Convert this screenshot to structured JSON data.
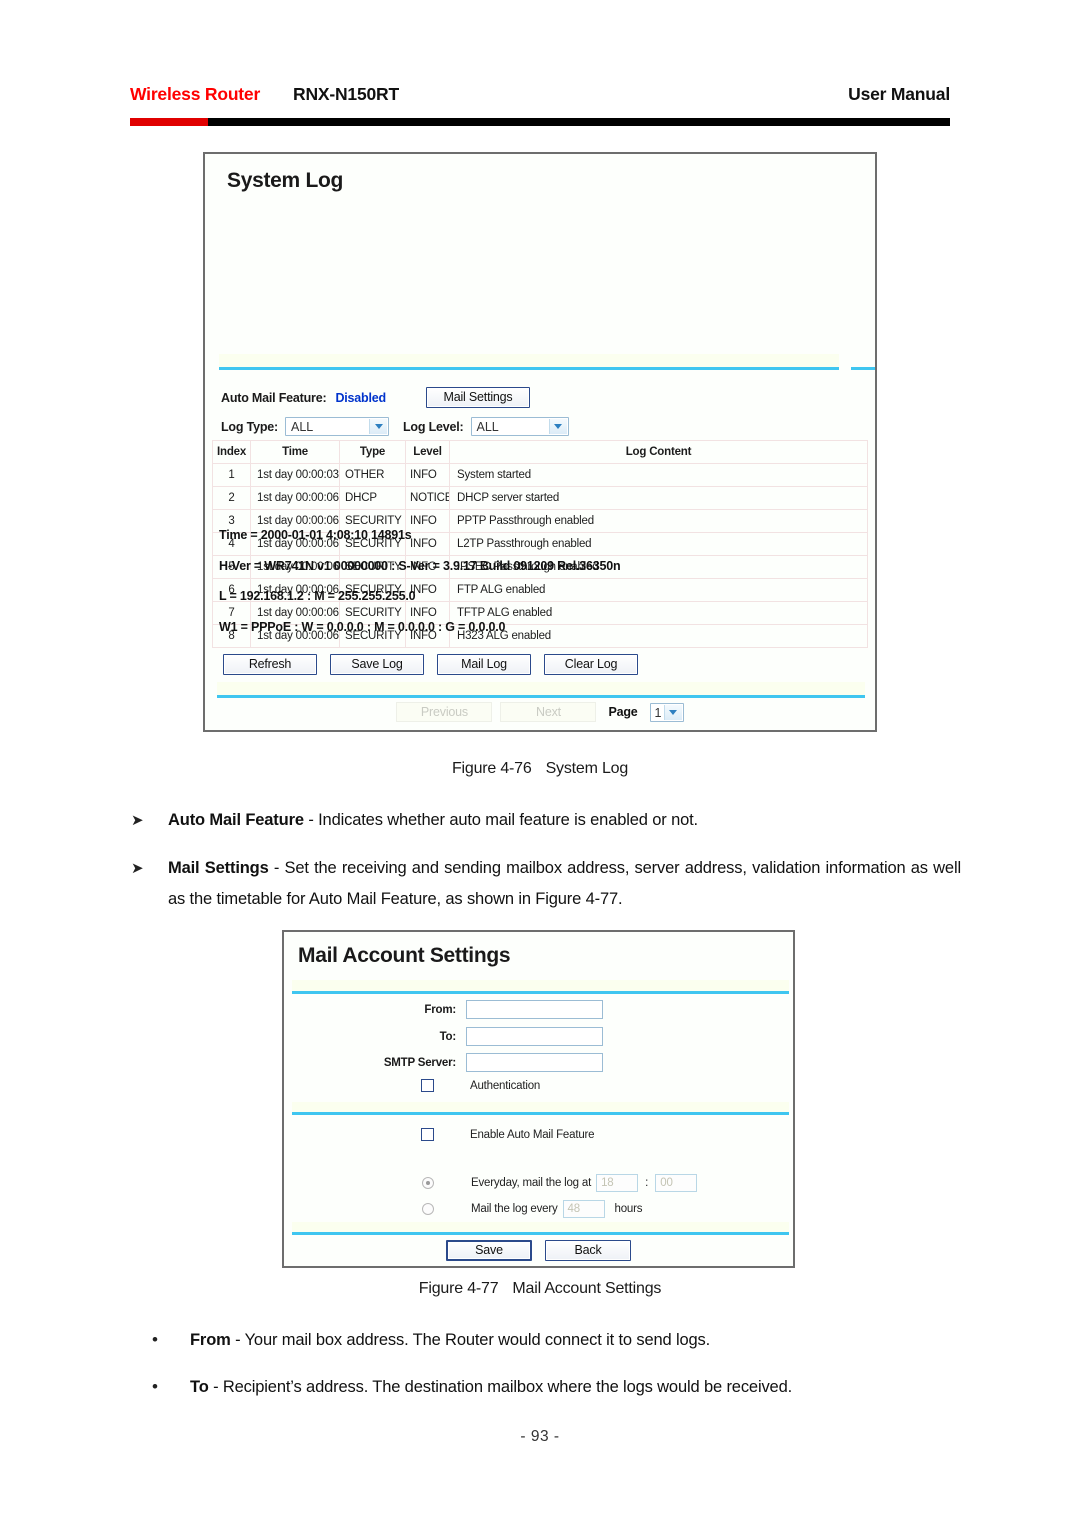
{
  "header": {
    "brand": "Wireless Router",
    "model": "RNX-N150RT",
    "manual": "User Manual",
    "brand_color": "#ff0000"
  },
  "system_log_panel": {
    "title": "System Log",
    "auto_mail_label": "Auto Mail Feature:",
    "auto_mail_value": "Disabled",
    "auto_mail_value_color": "#0033cc",
    "mail_settings_button": "Mail Settings",
    "log_type_label": "Log Type:",
    "log_type_value": "ALL",
    "log_level_label": "Log Level:",
    "log_level_value": "ALL",
    "table": {
      "headers": [
        "Index",
        "Time",
        "Type",
        "Level",
        "Log Content"
      ],
      "rows": [
        {
          "index": "1",
          "time": "1st day 00:00:03",
          "type": "OTHER",
          "level": "INFO",
          "content": "System started"
        },
        {
          "index": "2",
          "time": "1st day 00:00:06",
          "type": "DHCP",
          "level": "NOTICE",
          "content": "DHCP server started"
        },
        {
          "index": "3",
          "time": "1st day 00:00:06",
          "type": "SECURITY",
          "level": "INFO",
          "content": "PPTP Passthrough enabled"
        },
        {
          "index": "4",
          "time": "1st day 00:00:06",
          "type": "SECURITY",
          "level": "INFO",
          "content": "L2TP Passthrough enabled"
        },
        {
          "index": "5",
          "time": "1st day 00:00:06",
          "type": "SECURITY",
          "level": "INFO",
          "content": "IPSEC Passthrough enabled"
        },
        {
          "index": "6",
          "time": "1st day 00:00:06",
          "type": "SECURITY",
          "level": "INFO",
          "content": "FTP ALG enabled"
        },
        {
          "index": "7",
          "time": "1st day 00:00:06",
          "type": "SECURITY",
          "level": "INFO",
          "content": "TFTP ALG enabled"
        },
        {
          "index": "8",
          "time": "1st day 00:00:06",
          "type": "SECURITY",
          "level": "INFO",
          "content": "H323 ALG enabled"
        }
      ]
    },
    "info_lines": [
      "Time = 2000-01-01 4:08:10 14891s",
      "H-Ver = WR741N v1 00000000 : S-Ver = 3.9.17 Build 091209 Rel.36350n",
      "L = 192.168.1.2 : M = 255.255.255.0",
      "W1 = PPPoE : W = 0.0.0.0 : M = 0.0.0.0 : G = 0.0.0.0"
    ],
    "actions": [
      "Refresh",
      "Save Log",
      "Mail Log",
      "Clear Log"
    ],
    "pager": {
      "previous": "Previous",
      "next": "Next",
      "page_label": "Page",
      "page_value": "1"
    }
  },
  "figure_76": {
    "number": "Figure 4-76",
    "title": "System Log"
  },
  "body": {
    "auto_mail": {
      "marker": "➤",
      "term": "Auto Mail Feature",
      "text": " - Indicates whether auto mail feature is enabled or not."
    },
    "mail_settings": {
      "marker": "➤",
      "term": "Mail Settings",
      "text": " - Set the receiving and sending mailbox address, server address, validation information as well as the timetable for Auto Mail Feature, as shown in Figure 4-77."
    },
    "from": {
      "marker": "•",
      "term": "From",
      "text": " - Your mail box address. The Router would connect it to send logs."
    },
    "to": {
      "marker": "•",
      "term": "To",
      "text": " - Recipient’s address. The destination mailbox where the logs would be received."
    }
  },
  "mail_panel": {
    "title": "Mail Account Settings",
    "from_label": "From:",
    "from_value": "",
    "to_label": "To:",
    "to_value": "",
    "smtp_label": "SMTP Server:",
    "smtp_value": "",
    "authentication_label": "Authentication",
    "enable_auto_mail_label": "Enable Auto Mail Feature",
    "everyday_label": "Everyday, mail the log at",
    "everyday_hour": "18",
    "everyday_colon": ":",
    "everyday_minute": "00",
    "every_hours_label": "Mail the log every",
    "every_hours_value": "48",
    "hours_unit": "hours",
    "save_button": "Save",
    "back_button": "Back"
  },
  "figure_77": {
    "number": "Figure 4-77",
    "title": "Mail Account Settings"
  },
  "footer": {
    "page_number": "- 93 -"
  }
}
